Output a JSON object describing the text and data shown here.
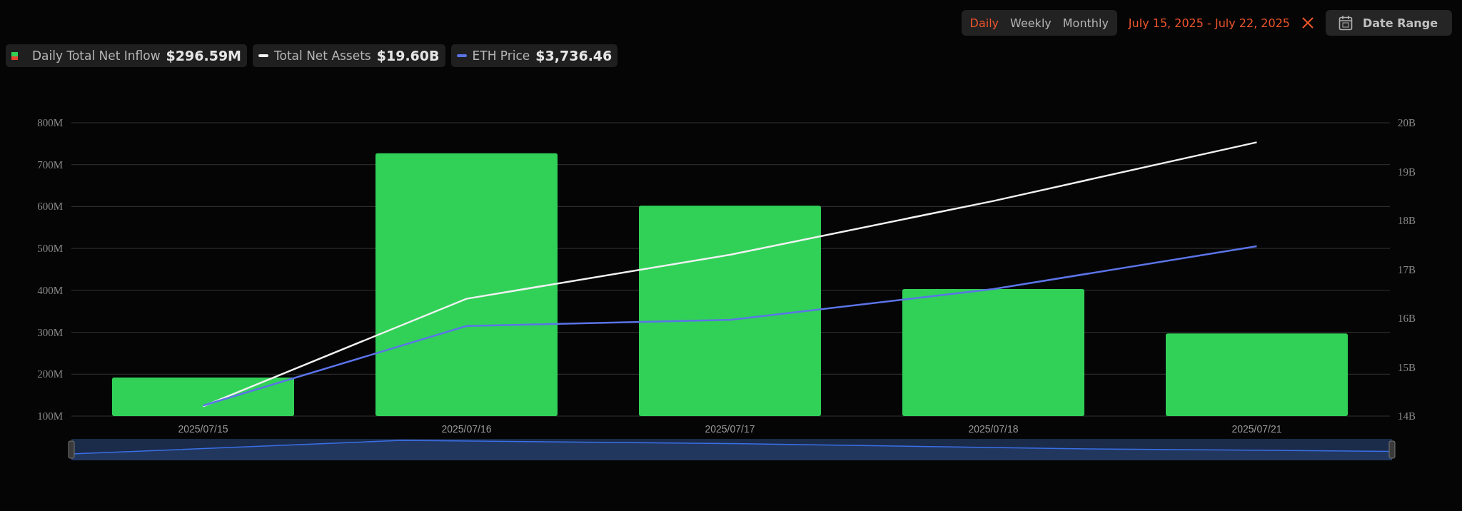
{
  "toolbar": {
    "periods": [
      {
        "label": "Daily",
        "selected": true
      },
      {
        "label": "Weekly",
        "selected": false
      },
      {
        "label": "Monthly",
        "selected": false
      }
    ],
    "date_range_text": "July 15, 2025 - July 22, 2025",
    "date_range_button": "Date Range"
  },
  "legend": [
    {
      "kind": "bars",
      "color": "#31d158",
      "value": "$296.59M"
    },
    {
      "kind": "line",
      "color": "#f2f2f2",
      "value": "$19.60B"
    },
    {
      "kind": "line",
      "color": "#5b74e8",
      "label": "ETH Price",
      "value": "$3,736.46"
    }
  ],
  "chart": {
    "chart_data": {
      "type": "bar",
      "categories": [
        "2025/07/15",
        "2025/07/16",
        "2025/07/17",
        "2025/07/18",
        "2025/07/21"
      ],
      "grid": true,
      "ylim": [
        100,
        800
      ],
      "yticks": [
        {
          "value": 800,
          "label": "800M"
        },
        {
          "value": 700,
          "label": "700M"
        },
        {
          "value": 600,
          "label": "600M"
        },
        {
          "value": 500,
          "label": "500M"
        },
        {
          "value": 400,
          "label": "400M"
        },
        {
          "value": 300,
          "label": "300M"
        },
        {
          "value": 200,
          "label": "200M"
        },
        {
          "value": 100,
          "label": "100M"
        }
      ],
      "y2lim": [
        14,
        20
      ],
      "y2ticks": [
        {
          "value": 20,
          "label": "20B"
        },
        {
          "value": 19,
          "label": "19B"
        },
        {
          "value": 18,
          "label": "18B"
        },
        {
          "value": 17,
          "label": "17B"
        },
        {
          "value": 16,
          "label": "16B"
        },
        {
          "value": 15,
          "label": "15B"
        },
        {
          "value": 14,
          "label": "14B"
        }
      ],
      "series": [
        {
          "name": "Daily Total Net Inflow",
          "color": "#31d158",
          "values": [
            192,
            727,
            602,
            403,
            297
          ]
        },
        {
          "name": "Total Net Assets",
          "type": "line",
          "axis": "y2",
          "color": "#f2f2f2",
          "values": [
            14.2,
            16.4,
            17.3,
            18.4,
            19.6
          ]
        }
      ]
    }
  }
}
